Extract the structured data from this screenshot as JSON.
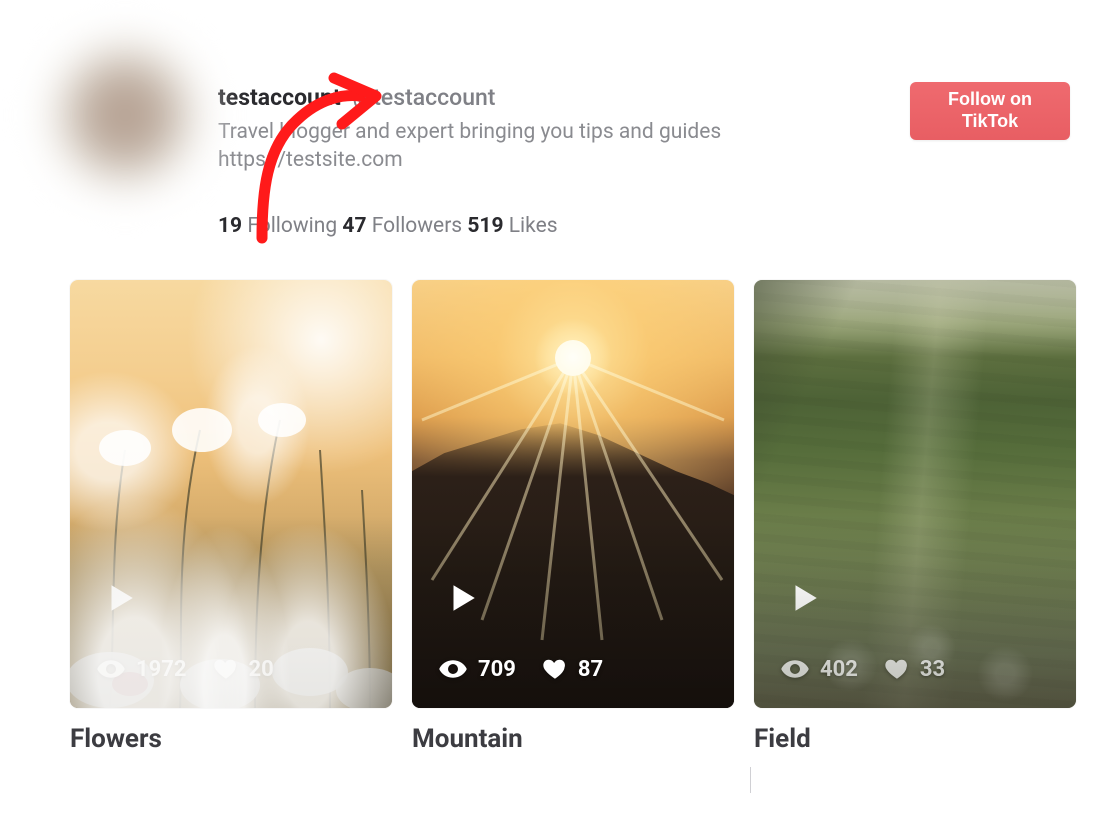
{
  "profile": {
    "display_name": "testaccount",
    "handle": "@testaccount",
    "bio_line1": "Travel blogger and expert bringing you tips and guides",
    "bio_line2": "https://testsite.com",
    "stats": {
      "following_count": "19",
      "following_label": "Following",
      "followers_count": "47",
      "followers_label": "Followers",
      "likes_count": "519",
      "likes_label": "Likes"
    },
    "follow_button": "Follow on\nTikTok"
  },
  "colors": {
    "follow_button_bg": "#ef6a6f",
    "annotation_arrow": "#ff1a1a"
  },
  "posts": [
    {
      "title": "Flowers",
      "views": "1972",
      "likes": "20"
    },
    {
      "title": "Mountain",
      "views": "709",
      "likes": "87"
    },
    {
      "title": "Field",
      "views": "402",
      "likes": "33"
    }
  ],
  "icons": {
    "play": "play-icon",
    "views": "eye-icon",
    "likes": "heart-icon"
  }
}
